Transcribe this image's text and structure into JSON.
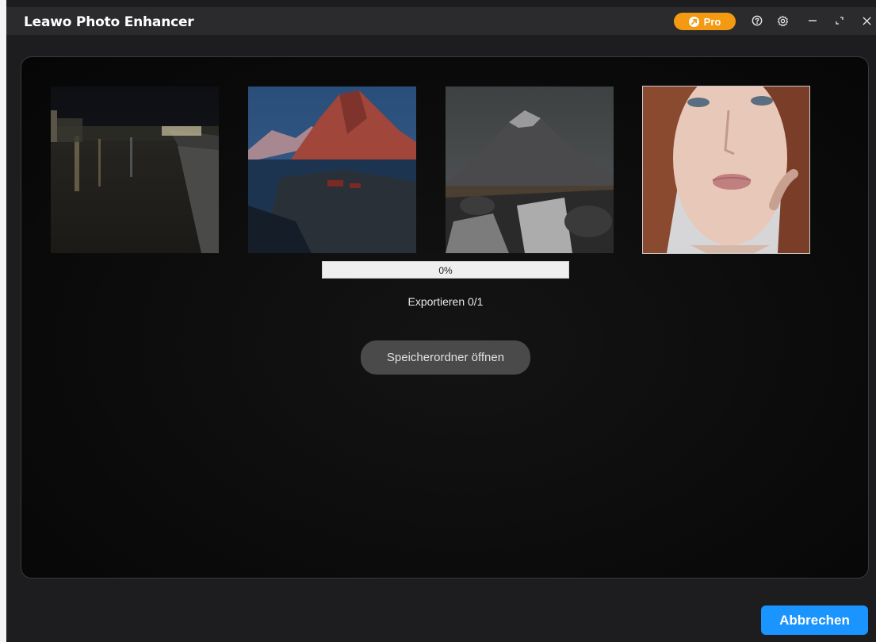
{
  "app": {
    "title": "Leawo Photo Enhancer"
  },
  "titlebar": {
    "pro_label": "Pro",
    "icons": [
      "rocket-icon",
      "help-icon",
      "gear-icon",
      "minimize-icon",
      "maximize-icon",
      "close-icon"
    ]
  },
  "thumbnails": [
    {
      "subject": "city-night-river"
    },
    {
      "subject": "red-mountain-lake"
    },
    {
      "subject": "mountain-waterfall"
    },
    {
      "subject": "portrait-woman"
    }
  ],
  "progress": {
    "value": 0,
    "label": "0%"
  },
  "export": {
    "status": "Exportieren 0/1"
  },
  "buttons": {
    "open_folder": "Speicherordner öffnen",
    "cancel": "Abbrechen"
  },
  "colors": {
    "accent": "#1a94ff",
    "pro": "#f39a12",
    "titlebar": "#2b2b2d",
    "background": "#1d1d1f"
  }
}
